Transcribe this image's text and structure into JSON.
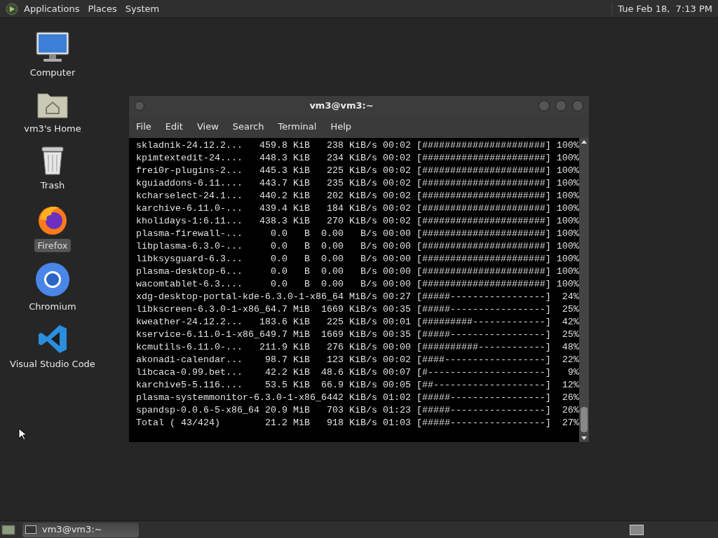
{
  "top_panel": {
    "menus": [
      "Applications",
      "Places",
      "System"
    ],
    "clock": "Tue Feb 18,  7:13 PM"
  },
  "desktop_icons": [
    {
      "kind": "computer",
      "label": "Computer",
      "selected": false
    },
    {
      "kind": "folder",
      "label": "vm3's Home",
      "selected": false
    },
    {
      "kind": "trash",
      "label": "Trash",
      "selected": false
    },
    {
      "kind": "firefox",
      "label": "Firefox",
      "selected": true
    },
    {
      "kind": "chromium",
      "label": "Chromium",
      "selected": false
    },
    {
      "kind": "vscode",
      "label": "Visual Studio Code",
      "selected": false
    }
  ],
  "terminal": {
    "title": "vm3@vm3:~",
    "menu": [
      "File",
      "Edit",
      "View",
      "Search",
      "Terminal",
      "Help"
    ],
    "lines": [
      "skladnik-24.12.2...   459.8 KiB   238 KiB/s 00:02 [######################] 100%",
      "kpimtextedit-24....   448.3 KiB   234 KiB/s 00:02 [######################] 100%",
      "frei0r-plugins-2...   445.3 KiB   225 KiB/s 00:02 [######################] 100%",
      "kguiaddons-6.11....   443.7 KiB   235 KiB/s 00:02 [######################] 100%",
      "kcharselect-24.1...   440.2 KiB   202 KiB/s 00:02 [######################] 100%",
      "karchive-6.11.0-...   439.4 KiB   184 KiB/s 00:02 [######################] 100%",
      "kholidays-1:6.11...   438.3 KiB   270 KiB/s 00:02 [######################] 100%",
      "plasma-firewall-...     0.0   B  0.00   B/s 00:00 [######################] 100%",
      "libplasma-6.3.0-...     0.0   B  0.00   B/s 00:00 [######################] 100%",
      "libksysguard-6.3...     0.0   B  0.00   B/s 00:00 [######################] 100%",
      "plasma-desktop-6...     0.0   B  0.00   B/s 00:00 [######################] 100%",
      "wacomtablet-6.3....     0.0   B  0.00   B/s 00:00 [######################] 100%",
      "xdg-desktop-portal-kde-6.3.0-1-x86_64 MiB/s 00:27 [#####-----------------]  24%",
      "libkscreen-6.3.0-1-x86_64.7 MiB  1669 KiB/s 00:35 [#####-----------------]  25%",
      "kweather-24.12.2...   183.6 KiB   225 KiB/s 00:01 [#########-------------]  42%",
      "kservice-6.11.0-1-x86_649.7 MiB  1669 KiB/s 00:35 [#####-----------------]  25%",
      "kcmutils-6.11.0-...   211.9 KiB   276 KiB/s 00:00 [##########------------]  48%",
      "akonadi-calendar...    98.7 KiB   123 KiB/s 00:02 [####------------------]  22%",
      "libcaca-0.99.bet...    42.2 KiB  48.6 KiB/s 00:07 [#---------------------]   9%",
      "karchive5-5.116....    53.5 KiB  66.9 KiB/s 00:05 [##--------------------]  12%",
      "plasma-systemmonitor-6.3.0-1-x86_6442 KiB/s 01:02 [#####-----------------]  26%",
      "spandsp-0.0.6-5-x86_64 20.9 MiB   703 KiB/s 01:23 [#####-----------------]  26%",
      "Total ( 43/424)        21.2 MiB   918 KiB/s 01:03 [#####-----------------]  27%"
    ]
  },
  "taskbar": {
    "windows": [
      {
        "label": "vm3@vm3:~",
        "selected": false
      }
    ]
  }
}
